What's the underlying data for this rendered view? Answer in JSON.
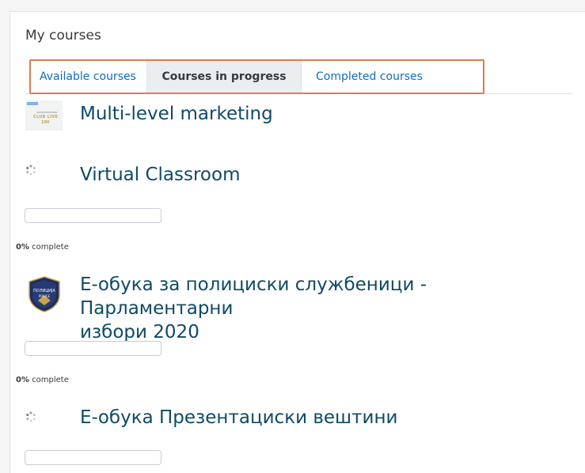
{
  "block": {
    "title": "My courses"
  },
  "tabs": [
    {
      "label": "Available courses",
      "active": false
    },
    {
      "label": "Courses in progress",
      "active": true
    },
    {
      "label": "Completed courses",
      "active": false
    }
  ],
  "courses": [
    {
      "name": "Multi-level marketing",
      "thumbnail": "club-live-100-image",
      "thumbnail_text": [
        "CLUB LIVE",
        "100"
      ],
      "progress": null
    },
    {
      "name": "Virtual Classroom",
      "thumbnail": "loading-spinner-icon",
      "progress": {
        "percent_value": 0,
        "percent": "0%",
        "suffix": " complete"
      }
    },
    {
      "name": "Е-обука за полициски службеници - Парламентарни избори 2020",
      "name_lines": [
        "Е-обука за полициски службеници - Парламентарни",
        "избори 2020"
      ],
      "thumbnail": "police-badge-icon",
      "badge_text": [
        "ПОЛИЦИЈА",
        "POLICE"
      ],
      "progress": {
        "percent_value": 0,
        "percent": "0%",
        "suffix": " complete"
      }
    },
    {
      "name": "Е-обука Презентациски вештини",
      "thumbnail": "loading-spinner-icon",
      "progress": {
        "percent_value": 0
      }
    }
  ],
  "colors": {
    "tab_highlight_border": "#e07a50",
    "course_link": "#0f4a66",
    "tab_link": "#0f6cbf",
    "active_tab_bg": "#ebeef1"
  }
}
